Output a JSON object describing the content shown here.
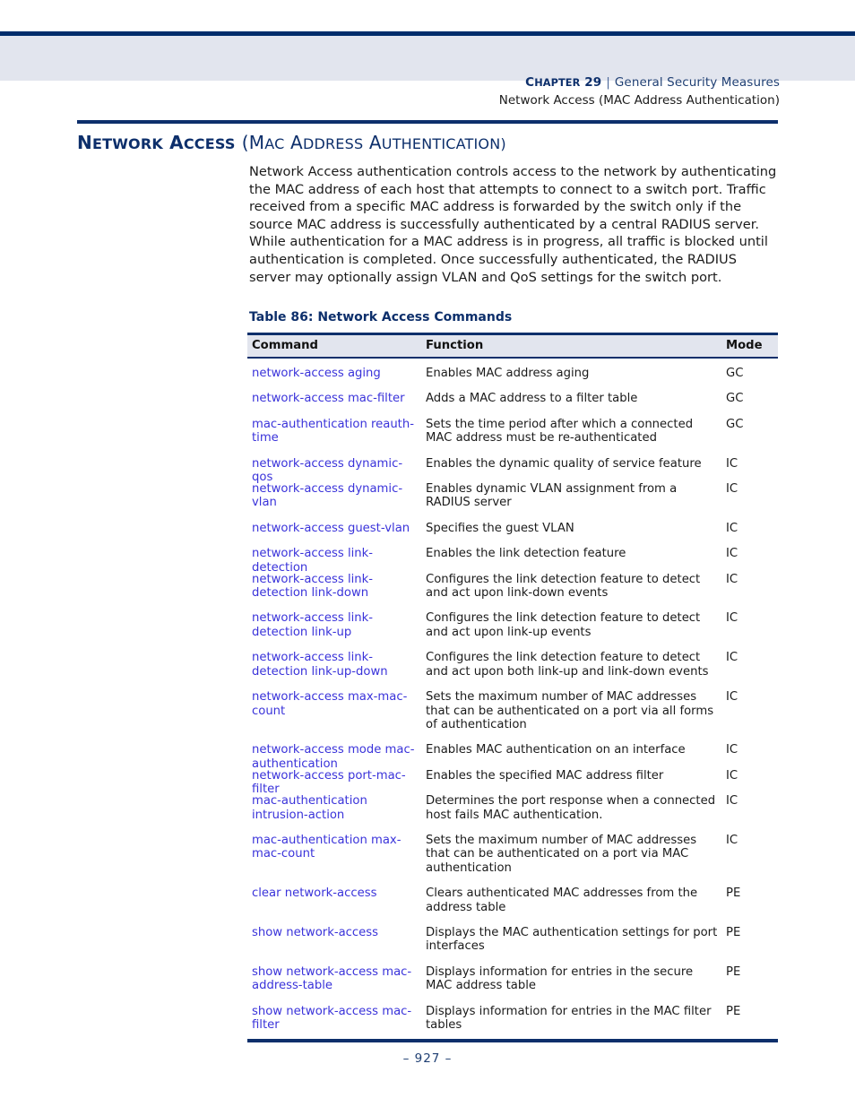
{
  "header": {
    "chapter_label": "Chapter",
    "chapter_number": "29",
    "separator": "|",
    "chapter_title": "General Security Measures",
    "subtitle": "Network Access (MAC Address Authentication)"
  },
  "section": {
    "title_bold": "Network Access",
    "title_regular": "(MAC Address Authentication)",
    "paragraph": "Network Access authentication controls access to the network by authenticating the MAC address of each host that attempts to connect to a switch port. Traffic received from a specific MAC address is forwarded by the switch only if the source MAC address is successfully authenticated by a central RADIUS server. While authentication for a MAC address is in progress, all traffic is blocked until authentication is completed. Once successfully authenticated, the RADIUS server may optionally assign VLAN and QoS settings for the switch port."
  },
  "table": {
    "caption": "Table 86: Network Access Commands",
    "columns": [
      "Command",
      "Function",
      "Mode"
    ],
    "rows": [
      {
        "command": "network-access aging",
        "function": "Enables MAC address aging",
        "mode": "GC"
      },
      {
        "command": "network-access mac-filter",
        "function": "Adds a MAC address to a filter table",
        "mode": "GC"
      },
      {
        "command": "mac-authentication reauth-time",
        "function": "Sets the time period after which a connected MAC address must be re-authenticated",
        "mode": "GC"
      },
      {
        "command": "network-access dynamic-qos",
        "function": "Enables the dynamic quality of service feature",
        "mode": "IC"
      },
      {
        "command": "network-access dynamic-vlan",
        "function": "Enables dynamic VLAN assignment from a RADIUS server",
        "mode": "IC"
      },
      {
        "command": "network-access guest-vlan",
        "function": "Specifies the guest VLAN",
        "mode": "IC"
      },
      {
        "command": "network-access link-detection",
        "function": "Enables the link detection feature",
        "mode": "IC"
      },
      {
        "command": "network-access link-detection link-down",
        "function": "Configures the link detection feature to detect and act upon link-down events",
        "mode": "IC"
      },
      {
        "command": "network-access link-detection link-up",
        "function": "Configures the link detection feature to detect and act upon link-up events",
        "mode": "IC"
      },
      {
        "command": "network-access link-detection link-up-down",
        "function": "Configures the link detection feature to detect and act upon both link-up and link-down events",
        "mode": "IC"
      },
      {
        "command": "network-access max-mac-count",
        "function": "Sets the maximum number of MAC addresses that can be authenticated on a port via all forms of authentication",
        "mode": "IC"
      },
      {
        "command": "network-access mode mac-authentication",
        "function": "Enables MAC authentication on an interface",
        "mode": "IC"
      },
      {
        "command": "network-access port-mac-filter",
        "function": "Enables the specified MAC address filter",
        "mode": "IC"
      },
      {
        "command": "mac-authentication intrusion-action",
        "function": "Determines the port response when a connected host fails MAC authentication.",
        "mode": "IC"
      },
      {
        "command": "mac-authentication max-mac-count",
        "function": "Sets the maximum number of MAC addresses that can be authenticated on a port via MAC authentication",
        "mode": "IC"
      },
      {
        "command": "clear network-access",
        "function": "Clears authenticated MAC addresses from the address table",
        "mode": "PE"
      },
      {
        "command": "show network-access",
        "function": "Displays the MAC authentication settings for port interfaces",
        "mode": "PE"
      },
      {
        "command": "show network-access mac-address-table",
        "function": "Displays information for entries in the secure MAC address table",
        "mode": "PE"
      },
      {
        "command": "show network-access mac-filter",
        "function": "Displays information for entries in the MAC filter tables",
        "mode": "PE"
      }
    ]
  },
  "footer": {
    "page_number": "–  927  –"
  },
  "colors": {
    "navy": "#0d2f6b",
    "header_band": "#e2e5ee",
    "link_blue": "#3a33da",
    "body_text": "#1b1b1b"
  }
}
